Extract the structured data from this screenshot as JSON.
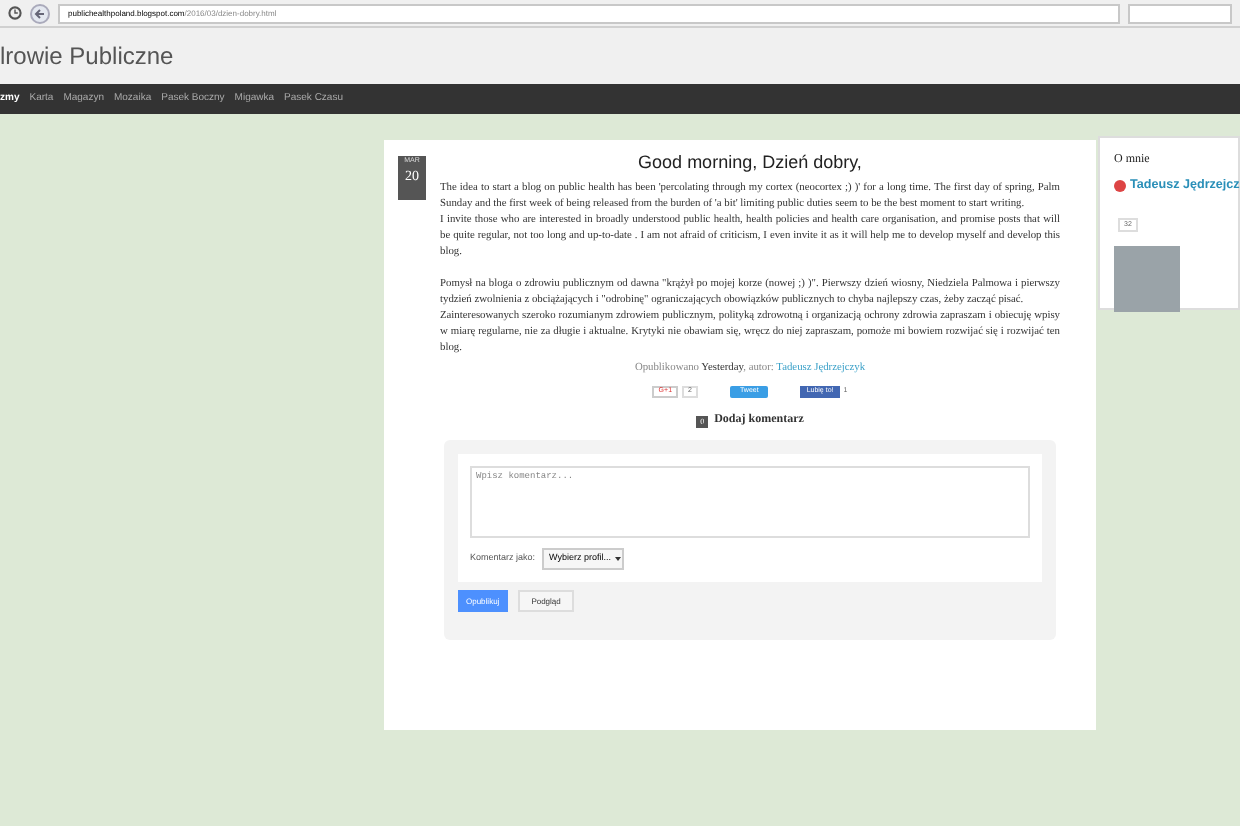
{
  "browser": {
    "url_host": "publichealthpoland.blogspot.com",
    "url_path": "/2016/03/dzien-dobry.html"
  },
  "blog": {
    "title": "lrowie Publiczne"
  },
  "nav": [
    {
      "label": "zmy",
      "selected": true
    },
    {
      "label": "Karta",
      "selected": false
    },
    {
      "label": "Magazyn",
      "selected": false
    },
    {
      "label": "Mozaika",
      "selected": false
    },
    {
      "label": "Pasek Boczny",
      "selected": false
    },
    {
      "label": "Migawka",
      "selected": false
    },
    {
      "label": "Pasek Czasu",
      "selected": false
    }
  ],
  "post": {
    "date_month": "MAR",
    "date_day": "20",
    "title": "Good morning, Dzień dobry,",
    "paragraphs": [
      "The idea to start a blog on public health has been 'percolating through my cortex (neocortex ;) )' for a long time. The first day of spring, Palm Sunday and the first week of being released from the burden of 'a bit' limiting public duties seem to be the best moment to start writing.",
      "I invite those who are interested in broadly understood public health, health policies and health care organisation, and promise posts that will be quite regular, not too long and up-to-date . I am not afraid of criticism, I even invite it as it will help me to develop myself and develop this blog.",
      "Pomysł na bloga o zdrowiu publicznym od dawna \"krążył po mojej korze (nowej ;) )\". Pierwszy dzień wiosny, Niedziela Palmowa i pierwszy tydzień zwolnienia z obciążających i \"odrobinę\" ograniczających obowiązków publicznych to chyba najlepszy czas, żeby zacząć pisać.",
      "Zainteresowanych szeroko rozumianym zdrowiem publicznym, polityką zdrowotną i organizacją ochrony zdrowia zapraszam i obiecuję wpisy w miarę regularne, nie za długie i aktualne. Krytyki nie obawiam się, wręcz do niej zapraszam, pomoże mi bowiem rozwijać się i rozwijać ten blog."
    ],
    "meta_prefix": "Opublikowano",
    "meta_time": "Yesterday",
    "meta_author_prefix": ", autor:",
    "meta_author": "Tadeusz Jędrzejczyk",
    "share": {
      "gplus": "G+1",
      "gplus_count": "2",
      "tweet": "Tweet",
      "like": "Lubię to!",
      "like_count": "1"
    },
    "comments": {
      "count": "0",
      "label": "Dodaj komentarz",
      "placeholder": "Wpisz komentarz...",
      "as_label": "Komentarz jako:",
      "profile": "Wybierz profil...",
      "publish": "Opublikuj",
      "preview": "Podgląd"
    }
  },
  "sidebar": {
    "title": "O mnie",
    "name": "Tadeusz Jędrzejcz",
    "count": "32"
  }
}
